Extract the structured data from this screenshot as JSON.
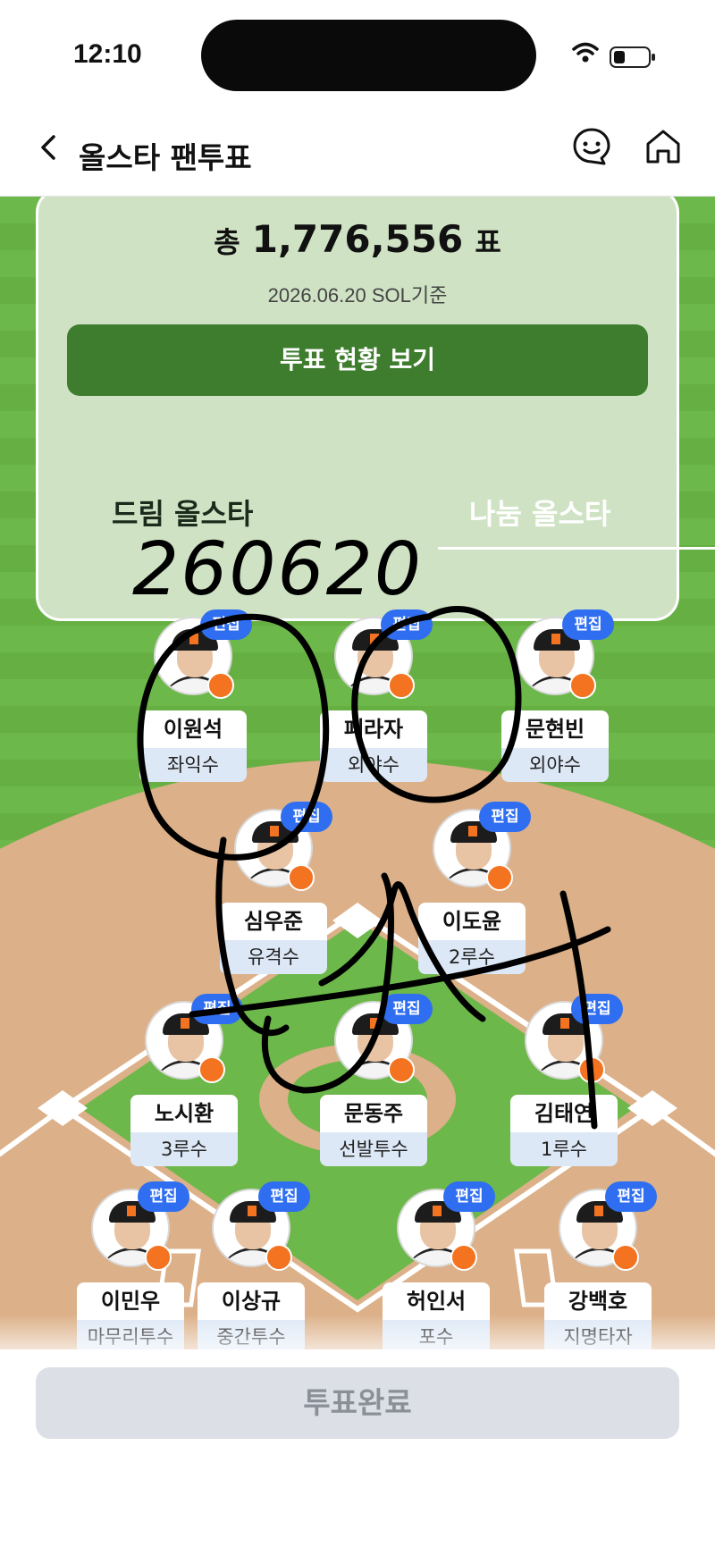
{
  "status_bar": {
    "time": "12:10"
  },
  "nav": {
    "title": "올스타 팬투표"
  },
  "vote_card": {
    "total_prefix": "총",
    "total_count": "1,776,556",
    "total_suffix": "표",
    "date": "2026.06.20 SOL기준",
    "status_button": "투표 현황 보기"
  },
  "tabs": {
    "dream": "드림 올스타",
    "nanum": "나눔 올스타"
  },
  "handwriting": {
    "date": "260620"
  },
  "edit_label": "편집",
  "players": [
    {
      "name": "이원석",
      "position": "좌익수"
    },
    {
      "name": "페라자",
      "position": "외야수"
    },
    {
      "name": "문현빈",
      "position": "외야수"
    },
    {
      "name": "심우준",
      "position": "유격수"
    },
    {
      "name": "이도윤",
      "position": "2루수"
    },
    {
      "name": "노시환",
      "position": "3루수"
    },
    {
      "name": "문동주",
      "position": "선발투수"
    },
    {
      "name": "김태연",
      "position": "1루수"
    },
    {
      "name": "이민우",
      "position": "마무리투수"
    },
    {
      "name": "이상규",
      "position": "중간투수"
    },
    {
      "name": "허인서",
      "position": "포수"
    },
    {
      "name": "강백호",
      "position": "지명타자"
    }
  ],
  "submit_button": "투표완료",
  "colors": {
    "grass": "#6db84a",
    "dirt": "#dcb088",
    "edit": "#2f6ef0",
    "card": "#cfe3c4",
    "button": "#3e7d2e"
  }
}
